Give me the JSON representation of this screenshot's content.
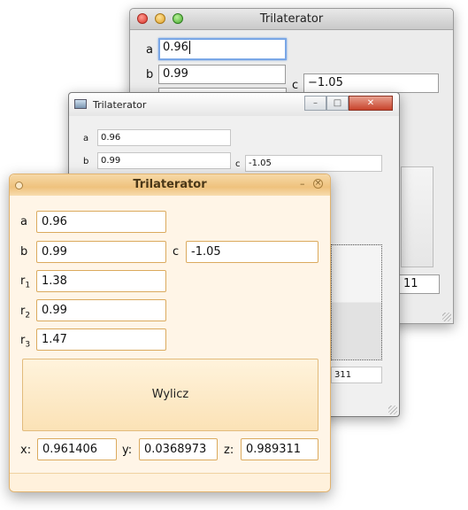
{
  "windows": {
    "mac": {
      "title": "Trilaterator",
      "a_label": "a",
      "a_value": "0.96",
      "b_label": "b",
      "b_value": "0.99",
      "c_label": "c",
      "c_value": "−1.05",
      "z_value": "11"
    },
    "win": {
      "title": "Trilaterator",
      "a_label": "a",
      "a_value": "0.96",
      "b_label": "b",
      "b_value": "0.99",
      "c_label": "c",
      "c_value": "-1.05",
      "z_value": "311",
      "min_glyph": "–",
      "max_glyph": "□",
      "close_glyph": "✕"
    },
    "qt": {
      "title": "Trilaterator",
      "a_label": "a",
      "a_value": "0.96",
      "b_label": "b",
      "b_value": "0.99",
      "c_label": "c",
      "c_value": "-1.05",
      "r_label": "r",
      "r1_sub": "1",
      "r1_value": "1.38",
      "r2_sub": "2",
      "r2_value": "0.99",
      "r3_sub": "3",
      "r3_value": "1.47",
      "compute_button": "Wylicz",
      "x_label": "x:",
      "x_value": "0.961406",
      "y_label": "y:",
      "y_value": "0.0368973",
      "z_label": "z:",
      "z_value": "0.989311",
      "min_glyph": "–",
      "close_glyph": "×"
    }
  },
  "colors": {
    "qt_accent": "#efc27d",
    "qt_field_border": "#dbaa5e",
    "mac_focus": "#7aa7e6",
    "win_close": "#c8432b"
  },
  "icons": {
    "mac_close": "close-light-icon",
    "mac_minimize": "minimize-light-icon",
    "mac_zoom": "zoom-light-icon",
    "win_app": "app-window-icon",
    "qt_menu": "window-menu-icon"
  }
}
